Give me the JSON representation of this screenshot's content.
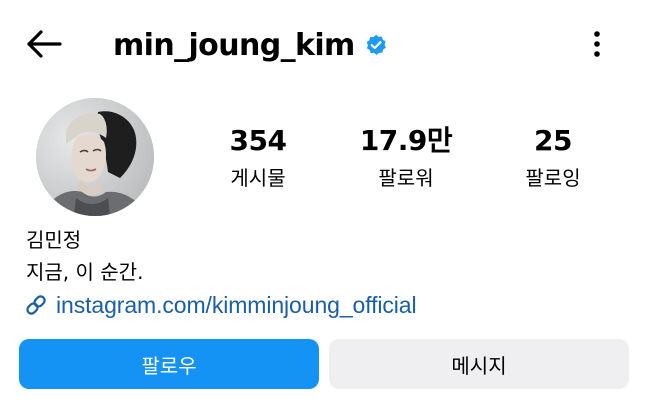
{
  "header": {
    "username": "min_joung_kim",
    "verified": true,
    "back_icon": "arrow-left-icon",
    "more_icon": "more-vertical-icon"
  },
  "stats": {
    "posts": {
      "value": "354",
      "label": "게시물"
    },
    "followers": {
      "value": "17.9만",
      "label": "팔로워"
    },
    "following": {
      "value": "25",
      "label": "팔로잉"
    }
  },
  "bio": {
    "display_name": "김민정",
    "text": "지금, 이 순간.",
    "link": "instagram.com/kimminjoung_official",
    "link_icon": "link-icon"
  },
  "actions": {
    "follow_label": "팔로우",
    "message_label": "메시지"
  },
  "colors": {
    "accent": "#1493f4",
    "link": "#1a5ea8",
    "secondary_button": "#efeff1",
    "verified_badge": "#1d9bf0"
  }
}
